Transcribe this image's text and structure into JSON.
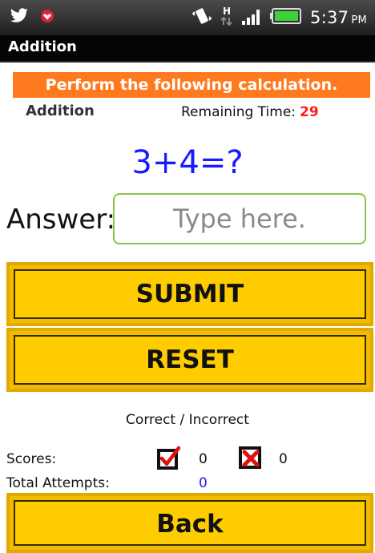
{
  "status_bar": {
    "time": "5:37",
    "ampm": "PM",
    "left_icons": [
      "twitter-icon",
      "notification-icon"
    ],
    "right_icons": [
      "vibrate-icon",
      "hspa-data-icon",
      "signal-icon",
      "battery-icon"
    ],
    "network_label": "H"
  },
  "titlebar": {
    "title": "Addition"
  },
  "instruction": {
    "text": "Perform the following calculation."
  },
  "quiz": {
    "mode": "Addition",
    "remaining_label": "Remaining Time:",
    "remaining_value": "29",
    "question": "3+4=?"
  },
  "answer": {
    "label": "Answer:",
    "value": "",
    "placeholder": "Type here."
  },
  "buttons": {
    "submit": "SUBMIT",
    "reset": "RESET",
    "back": "Back"
  },
  "scores": {
    "header": "Correct / Incorrect",
    "label": "Scores:",
    "correct": "0",
    "incorrect": "0",
    "attempts_label": "Total Attempts:",
    "attempts": "0"
  },
  "colors": {
    "banner": "#ff7a1f",
    "question": "#1a1aff",
    "remaining_value": "#ff1a1a",
    "button": "#ffcc00",
    "input_border": "#8bc34a"
  }
}
